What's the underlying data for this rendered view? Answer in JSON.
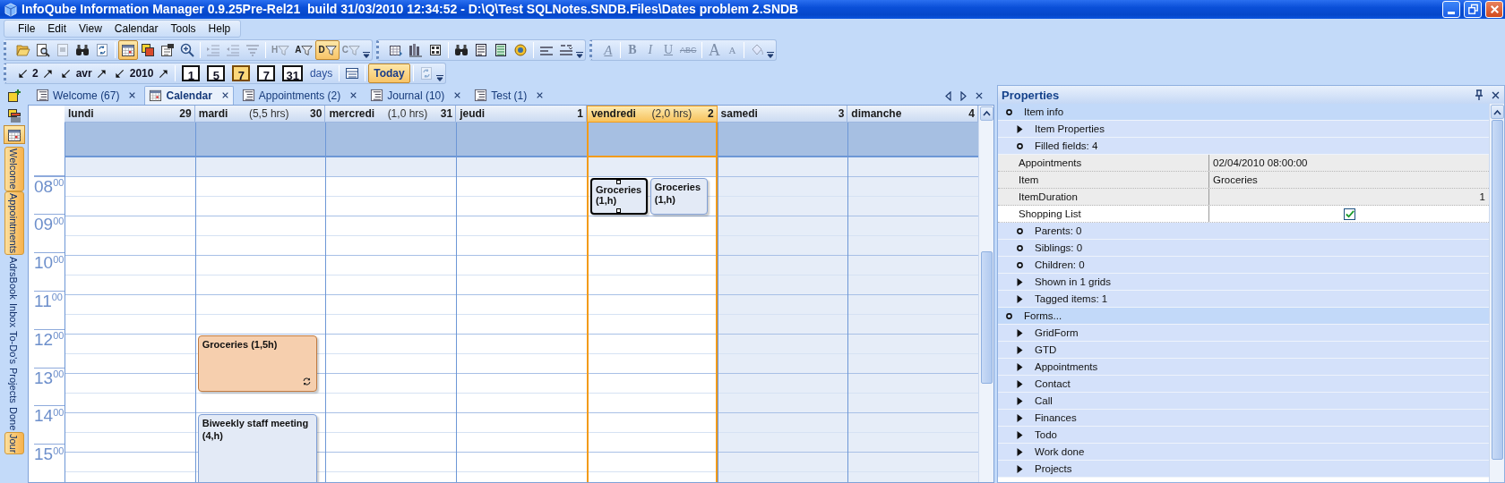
{
  "window": {
    "title": "InfoQube Information Manager 0.9.25Pre-Rel21  build 31/03/2010 12:34:52 - D:\\Q\\Test SQLNotes.SNDB.Files\\Dates problem 2.SNDB"
  },
  "menu": [
    "File",
    "Edit",
    "View",
    "Calendar",
    "Tools",
    "Help"
  ],
  "toolbar_rows": [
    [
      [
        {
          "kind": "folder",
          "pressed": false,
          "disabled": false
        },
        {
          "kind": "preview",
          "pressed": false,
          "disabled": false
        },
        {
          "kind": "page",
          "pressed": false,
          "disabled": true
        },
        {
          "kind": "binoculars",
          "pressed": false,
          "disabled": false
        },
        {
          "kind": "refresh",
          "pressed": false,
          "disabled": false
        },
        {
          "kind": "sep"
        },
        {
          "kind": "calendar",
          "pressed": true,
          "disabled": false
        },
        {
          "kind": "squares",
          "pressed": false,
          "disabled": false
        },
        {
          "kind": "properties",
          "pressed": false,
          "disabled": false
        },
        {
          "kind": "zoom",
          "pressed": false,
          "disabled": false
        },
        {
          "kind": "sep"
        },
        {
          "kind": "indent",
          "pressed": false,
          "disabled": true
        },
        {
          "kind": "outdent",
          "pressed": false,
          "disabled": true
        },
        {
          "kind": "sort",
          "pressed": false,
          "disabled": true
        },
        {
          "kind": "sep"
        },
        {
          "kind": "filter",
          "label": "H",
          "pressed": false,
          "disabled": true
        },
        {
          "kind": "filter",
          "label": "A",
          "pressed": false,
          "disabled": false
        },
        {
          "kind": "filter",
          "label": "D",
          "pressed": true,
          "disabled": false
        },
        {
          "kind": "filter",
          "label": "C",
          "pressed": false,
          "disabled": true
        },
        {
          "kind": "overflow"
        }
      ],
      [
        {
          "kind": "grid-add",
          "pressed": false,
          "disabled": false
        },
        {
          "kind": "books",
          "pressed": false,
          "disabled": false
        },
        {
          "kind": "table",
          "pressed": false,
          "disabled": false
        },
        {
          "kind": "sep"
        },
        {
          "kind": "binoculars",
          "pressed": false,
          "disabled": false
        },
        {
          "kind": "doc",
          "pressed": false,
          "disabled": false
        },
        {
          "kind": "doc-green",
          "pressed": false,
          "disabled": false
        },
        {
          "kind": "coin",
          "pressed": false,
          "disabled": false
        },
        {
          "kind": "sep"
        },
        {
          "kind": "lines",
          "pressed": false,
          "disabled": false
        },
        {
          "kind": "lines-arrow",
          "pressed": false,
          "disabled": false
        },
        {
          "kind": "overflow"
        }
      ],
      [
        {
          "kind": "text-style",
          "label": "A",
          "pressed": false,
          "disabled": true
        },
        {
          "kind": "sep"
        },
        {
          "kind": "bold",
          "label": "B",
          "pressed": false,
          "disabled": true
        },
        {
          "kind": "italic",
          "label": "I",
          "pressed": false,
          "disabled": true
        },
        {
          "kind": "underline",
          "label": "U",
          "pressed": false,
          "disabled": true
        },
        {
          "kind": "strike",
          "label": "ABC",
          "pressed": false,
          "disabled": true
        },
        {
          "kind": "sep"
        },
        {
          "kind": "font-grow",
          "label": "A",
          "pressed": false,
          "disabled": true
        },
        {
          "kind": "font-shrink",
          "label": "A",
          "pressed": false,
          "disabled": true
        },
        {
          "kind": "sep"
        },
        {
          "kind": "bucket",
          "pressed": false,
          "disabled": true
        },
        {
          "kind": "overflow"
        }
      ]
    ],
    [
      [
        {
          "kind": "spinner",
          "label": "2"
        },
        {
          "kind": "spinner",
          "label": "avr"
        },
        {
          "kind": "spinner",
          "label": "2010"
        },
        {
          "kind": "sep"
        },
        {
          "kind": "day-button",
          "label": "1",
          "pressed": false,
          "disabled": false
        },
        {
          "kind": "day-button",
          "label": "5",
          "pressed": false,
          "disabled": false
        },
        {
          "kind": "day-button",
          "label": "7",
          "pressed": true,
          "disabled": false
        },
        {
          "kind": "day-button",
          "label": "7",
          "pressed": false,
          "disabled": false
        },
        {
          "kind": "day-button",
          "label": "31",
          "pressed": false,
          "disabled": false
        },
        {
          "kind": "caption",
          "label": "days"
        },
        {
          "kind": "sep"
        },
        {
          "kind": "schedule",
          "pressed": false,
          "disabled": false
        },
        {
          "kind": "sep"
        },
        {
          "kind": "text-button",
          "label": "Today",
          "pressed": true,
          "disabled": false
        },
        {
          "kind": "sep"
        },
        {
          "kind": "refresh",
          "pressed": false,
          "disabled": true
        },
        {
          "kind": "overflow"
        }
      ]
    ]
  ],
  "sidebar": {
    "tools": [
      {
        "kind": "add",
        "pressed": false
      },
      {
        "kind": "stack",
        "pressed": false
      },
      {
        "kind": "calendar",
        "pressed": true
      }
    ],
    "tabs": [
      {
        "label": "Welcome",
        "selected": true
      },
      {
        "label": "Appointments",
        "selected": true
      },
      {
        "label": "AdrsBook",
        "selected": false
      },
      {
        "label": "Inbox",
        "selected": false
      },
      {
        "label": "To-Do's",
        "selected": false
      },
      {
        "label": "Projects",
        "selected": false
      },
      {
        "label": "Done",
        "selected": false
      },
      {
        "label": "Jour",
        "selected": true
      }
    ]
  },
  "tabs": [
    {
      "label": "Welcome (67)",
      "kind": "list",
      "selected": false
    },
    {
      "label": "Calendar",
      "kind": "calendar",
      "selected": true
    },
    {
      "label": "Appointments (2)",
      "kind": "list",
      "selected": false
    },
    {
      "label": "Journal (10)",
      "kind": "list",
      "selected": false
    },
    {
      "label": "Test (1)",
      "kind": "list",
      "selected": false
    }
  ],
  "calendar": {
    "hours": [
      {
        "hour": "08",
        "minutes": "00"
      },
      {
        "hour": "09",
        "minutes": "00"
      },
      {
        "hour": "10",
        "minutes": "00"
      },
      {
        "hour": "11",
        "minutes": "00"
      },
      {
        "hour": "12",
        "minutes": "00"
      },
      {
        "hour": "13",
        "minutes": "00"
      },
      {
        "hour": "14",
        "minutes": "00"
      },
      {
        "hour": "15",
        "minutes": "00"
      }
    ],
    "days": [
      {
        "name": "lundi",
        "date": "29",
        "today": false,
        "slots": [
          {
            "off_hours": true
          },
          {
            "off_hours": false
          },
          {
            "off_hours": false
          },
          {
            "off_hours": false
          },
          {
            "off_hours": false
          },
          {
            "off_hours": false
          },
          {
            "off_hours": false
          },
          {
            "off_hours": false
          },
          {
            "off_hours": false
          },
          {
            "off_hours": false
          },
          {
            "off_hours": false
          },
          {
            "off_hours": false
          },
          {
            "off_hours": false
          },
          {
            "off_hours": false
          },
          {
            "off_hours": false
          },
          {
            "off_hours": false
          },
          {
            "off_hours": false
          }
        ]
      },
      {
        "name": "mardi",
        "hours": "(5,5 hrs)",
        "date": "30",
        "today": false,
        "slots": [
          {
            "off_hours": true
          },
          {
            "off_hours": false
          },
          {
            "off_hours": false
          },
          {
            "off_hours": false
          },
          {
            "off_hours": false
          },
          {
            "off_hours": false
          },
          {
            "off_hours": false
          },
          {
            "off_hours": false
          },
          {
            "off_hours": false
          },
          {
            "off_hours": false,
            "events": [
              {
                "kind": "start",
                "title": "Groceries (1,5h)",
                "color": "#f6cfae",
                "selected": false,
                "recurring": true
              }
            ]
          },
          {
            "off_hours": false,
            "events": [
              {
                "kind": "continuation"
              }
            ]
          },
          {
            "off_hours": false,
            "events": [
              {
                "kind": "continuation"
              }
            ]
          },
          {
            "off_hours": false
          },
          {
            "off_hours": false,
            "events": [
              {
                "kind": "start",
                "title": "Biweekly staff meeting (4,h)",
                "color": "#e3eaf6",
                "selected": false,
                "recurring": false
              }
            ]
          },
          {
            "off_hours": false,
            "events": [
              {
                "kind": "continuation"
              }
            ]
          },
          {
            "off_hours": false,
            "events": [
              {
                "kind": "continuation"
              }
            ]
          },
          {
            "off_hours": false,
            "events": [
              {
                "kind": "continuation"
              }
            ]
          }
        ]
      },
      {
        "name": "mercredi",
        "hours": "(1,0 hrs)",
        "date": "31",
        "today": false,
        "slots": [
          {
            "off_hours": true
          },
          {
            "off_hours": false
          },
          {
            "off_hours": false
          },
          {
            "off_hours": false
          },
          {
            "off_hours": false
          },
          {
            "off_hours": false
          },
          {
            "off_hours": false
          },
          {
            "off_hours": false
          },
          {
            "off_hours": false
          },
          {
            "off_hours": false
          },
          {
            "off_hours": false
          },
          {
            "off_hours": false
          },
          {
            "off_hours": false
          },
          {
            "off_hours": false
          },
          {
            "off_hours": false
          },
          {
            "off_hours": false
          },
          {
            "off_hours": false
          }
        ]
      },
      {
        "name": "jeudi",
        "date": "1",
        "today": false,
        "slots": [
          {
            "off_hours": true
          },
          {
            "off_hours": false
          },
          {
            "off_hours": false
          },
          {
            "off_hours": false
          },
          {
            "off_hours": false
          },
          {
            "off_hours": false
          },
          {
            "off_hours": false
          },
          {
            "off_hours": false
          },
          {
            "off_hours": false
          },
          {
            "off_hours": false
          },
          {
            "off_hours": false
          },
          {
            "off_hours": false
          },
          {
            "off_hours": false
          },
          {
            "off_hours": false
          },
          {
            "off_hours": false
          },
          {
            "off_hours": false
          },
          {
            "off_hours": false
          }
        ]
      },
      {
        "name": "vendredi",
        "hours": "(2,0 hrs)",
        "date": "2",
        "today": true,
        "slots": [
          {
            "off_hours": true
          },
          {
            "off_hours": false,
            "events": [
              {
                "kind": "start",
                "title": "Groceries (1,h)",
                "color": "#e3eaf6",
                "selected": true,
                "recurring": false
              },
              {
                "kind": "start",
                "title": "Groceries (1,h)",
                "color": "#e3eaf6",
                "selected": false,
                "recurring": false
              }
            ]
          },
          {
            "off_hours": false,
            "events": [
              {
                "kind": "continuation"
              },
              {
                "kind": "continuation"
              }
            ]
          },
          {
            "off_hours": false
          },
          {
            "off_hours": false
          },
          {
            "off_hours": false
          },
          {
            "off_hours": false
          },
          {
            "off_hours": false
          },
          {
            "off_hours": false
          },
          {
            "off_hours": false
          },
          {
            "off_hours": false
          },
          {
            "off_hours": false
          },
          {
            "off_hours": false
          },
          {
            "off_hours": false
          },
          {
            "off_hours": false
          },
          {
            "off_hours": false
          },
          {
            "off_hours": false
          }
        ]
      },
      {
        "name": "samedi",
        "date": "3",
        "today": false,
        "slots": [
          {
            "off_hours": true
          },
          {
            "off_hours": true
          },
          {
            "off_hours": true
          },
          {
            "off_hours": true
          },
          {
            "off_hours": true
          },
          {
            "off_hours": true
          },
          {
            "off_hours": true
          },
          {
            "off_hours": true
          },
          {
            "off_hours": true
          },
          {
            "off_hours": true
          },
          {
            "off_hours": true
          },
          {
            "off_hours": true
          },
          {
            "off_hours": true
          },
          {
            "off_hours": true
          },
          {
            "off_hours": true
          },
          {
            "off_hours": true
          },
          {
            "off_hours": true
          }
        ]
      },
      {
        "name": "dimanche",
        "date": "4",
        "today": false,
        "slots": [
          {
            "off_hours": true
          },
          {
            "off_hours": true
          },
          {
            "off_hours": true
          },
          {
            "off_hours": true
          },
          {
            "off_hours": true
          },
          {
            "off_hours": true
          },
          {
            "off_hours": true
          },
          {
            "off_hours": true
          },
          {
            "off_hours": true
          },
          {
            "off_hours": true
          },
          {
            "off_hours": true
          },
          {
            "off_hours": true
          },
          {
            "off_hours": true
          },
          {
            "off_hours": true
          },
          {
            "off_hours": true
          },
          {
            "off_hours": true
          },
          {
            "off_hours": true
          }
        ]
      }
    ]
  },
  "properties": {
    "title": "Properties",
    "rows": [
      {
        "kind": "section",
        "label": "Item info",
        "expanded": true,
        "children": [
          {
            "kind": "group",
            "label": "Item Properties",
            "expanded": false
          },
          {
            "kind": "group",
            "label": "Filled fields: 4",
            "expanded": true,
            "children": [
              {
                "kind": "field",
                "label": "Appointments",
                "value": "02/04/2010 08:00:00",
                "selected": false
              },
              {
                "kind": "field",
                "label": "Item",
                "value": "Groceries",
                "selected": false
              },
              {
                "kind": "number",
                "label": "ItemDuration",
                "value": "1",
                "selected": false
              },
              {
                "kind": "check",
                "label": "Shopping List",
                "checked": true,
                "selected": true
              }
            ]
          },
          {
            "kind": "group",
            "label": "Parents: 0",
            "expanded": true
          },
          {
            "kind": "group",
            "label": "Siblings: 0",
            "expanded": true
          },
          {
            "kind": "group",
            "label": "Children: 0",
            "expanded": true
          },
          {
            "kind": "group",
            "label": "Shown in 1 grids",
            "expanded": false
          },
          {
            "kind": "group",
            "label": "Tagged items: 1",
            "expanded": false
          }
        ]
      },
      {
        "kind": "section",
        "label": "Forms...",
        "expanded": true,
        "children": [
          {
            "kind": "group",
            "label": "GridForm",
            "expanded": false
          },
          {
            "kind": "group",
            "label": "GTD",
            "expanded": false
          },
          {
            "kind": "group",
            "label": "Appointments",
            "expanded": false
          },
          {
            "kind": "group",
            "label": "Contact",
            "expanded": false
          },
          {
            "kind": "group",
            "label": "Call",
            "expanded": false
          },
          {
            "kind": "group",
            "label": "Finances",
            "expanded": false
          },
          {
            "kind": "group",
            "label": "Todo",
            "expanded": false
          },
          {
            "kind": "group",
            "label": "Work done",
            "expanded": false
          },
          {
            "kind": "group",
            "label": "Projects",
            "expanded": false
          }
        ]
      }
    ]
  }
}
